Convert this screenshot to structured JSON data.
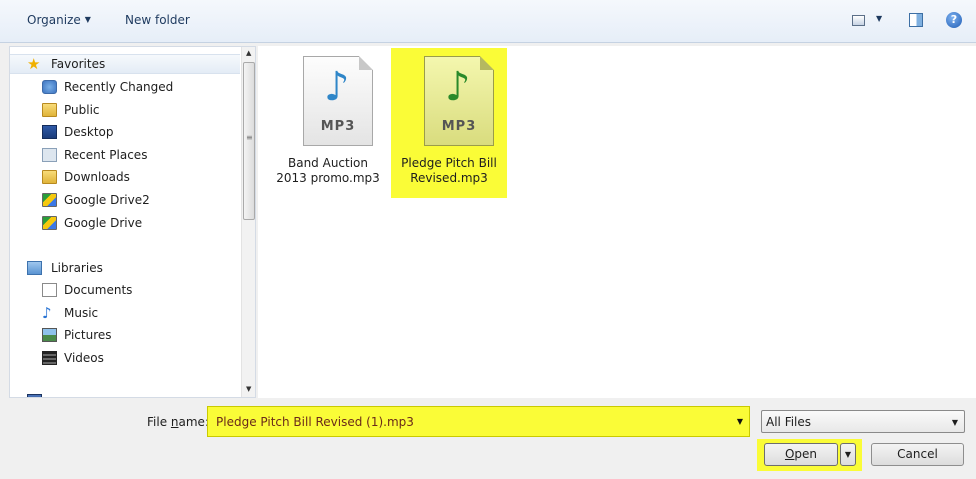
{
  "toolbar": {
    "organize_label": "Organize",
    "new_folder_label": "New folder",
    "views_icon": "views-icon",
    "preview_icon": "preview-pane-icon",
    "help_icon": "help-icon",
    "help_glyph": "?"
  },
  "nav": {
    "favorites": {
      "label": "Favorites",
      "items": [
        {
          "label": "Recently Changed",
          "icon": "recently-changed-icon"
        },
        {
          "label": "Public",
          "icon": "folder-icon"
        },
        {
          "label": "Desktop",
          "icon": "desktop-icon"
        },
        {
          "label": "Recent Places",
          "icon": "recent-places-icon"
        },
        {
          "label": "Downloads",
          "icon": "downloads-icon"
        },
        {
          "label": "Google Drive2",
          "icon": "google-drive-icon"
        },
        {
          "label": "Google Drive",
          "icon": "google-drive-icon"
        }
      ]
    },
    "libraries": {
      "label": "Libraries",
      "items": [
        {
          "label": "Documents",
          "icon": "documents-icon"
        },
        {
          "label": "Music",
          "icon": "music-icon"
        },
        {
          "label": "Pictures",
          "icon": "pictures-icon"
        },
        {
          "label": "Videos",
          "icon": "videos-icon"
        }
      ]
    }
  },
  "files": [
    {
      "ext": "MP3",
      "name_line1": "Band Auction",
      "name_line2": "2013 promo.mp3",
      "selected": false,
      "icon": "mp3-file-icon"
    },
    {
      "ext": "MP3",
      "name_line1": "Pledge Pitch Bill",
      "name_line2": "Revised.mp3",
      "selected": true,
      "icon": "mp3-file-icon"
    }
  ],
  "bottom": {
    "filename_label_pre": "File ",
    "filename_label_accel": "n",
    "filename_label_post": "ame:",
    "filename_value": "Pledge Pitch Bill Revised (1).mp3",
    "filetype_value": "All Files",
    "open_accel": "O",
    "open_rest": "pen",
    "cancel_label": "Cancel"
  },
  "colors": {
    "highlight": "#fafc37",
    "window_bg": "#f0f0f0"
  }
}
